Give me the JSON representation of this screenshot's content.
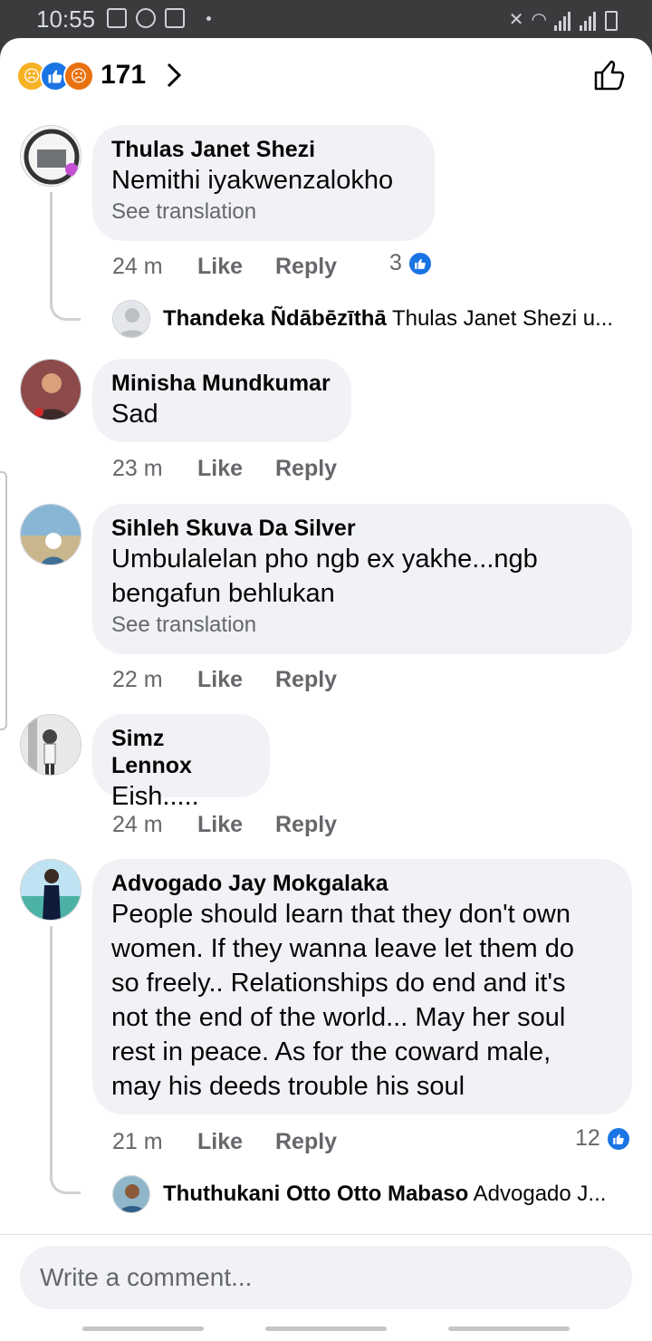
{
  "status_bar": {
    "time": "10:55"
  },
  "reaction_bar": {
    "count": "171"
  },
  "comments": [
    {
      "author": "Thulas Janet Shezi",
      "text": "Nemithi iyakwenzalokho",
      "see_translation": "See translation",
      "time": "24 m",
      "like": "Like",
      "reply": "Reply",
      "likes": "3",
      "reply_preview": {
        "author": "Thandeka Ñdābēzīthā",
        "text": "Thulas Janet Shezi u..."
      }
    },
    {
      "author": "Minisha Mundkumar",
      "text": "Sad",
      "time": "23 m",
      "like": "Like",
      "reply": "Reply"
    },
    {
      "author": "Sihleh Skuva Da Silver",
      "text": "Umbulalelan pho ngb ex yakhe...ngb\nbengafun behlukan",
      "see_translation": "See translation",
      "time": "22 m",
      "like": "Like",
      "reply": "Reply"
    },
    {
      "author": "Simz Lennox",
      "text": "Eish.....",
      "time": "24 m",
      "like": "Like",
      "reply": "Reply"
    },
    {
      "author": "Advogado Jay Mokgalaka",
      "text": "People should learn that they don't own\nwomen. If they wanna leave let them do\nso freely.. Relationships do end and it's\nnot the end of the world... May her soul\nrest in peace. As for the coward male,\nmay his deeds trouble his soul",
      "time": "21 m",
      "like": "Like",
      "reply": "Reply",
      "likes": "12",
      "reply_preview": {
        "author": "Thuthukani Otto Otto Mabaso",
        "text": "Advogado J..."
      }
    }
  ],
  "composer": {
    "placeholder": "Write a comment..."
  },
  "colors": {
    "accent": "#1b74e4",
    "bubble": "#f0f2f5",
    "muted": "#65676b"
  }
}
